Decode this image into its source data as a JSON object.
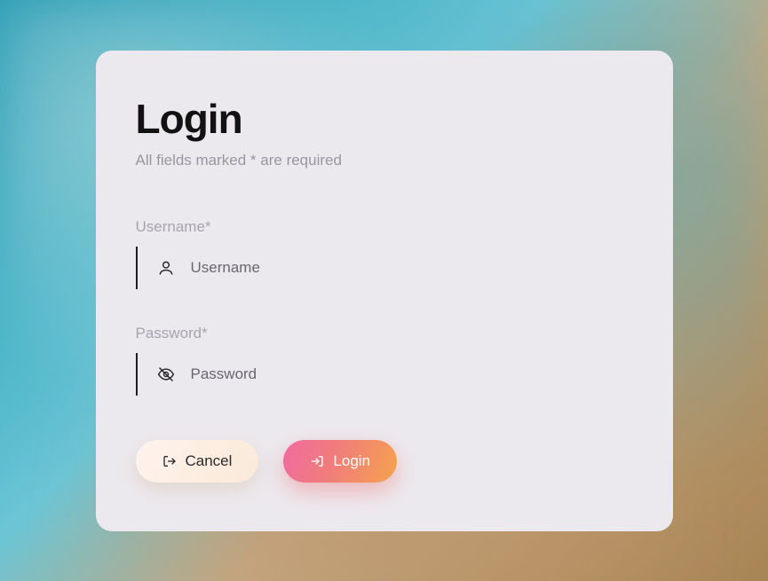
{
  "header": {
    "title": "Login",
    "subtitle": "All fields marked * are required"
  },
  "fields": {
    "username": {
      "label": "Username*",
      "placeholder": "Username",
      "value": ""
    },
    "password": {
      "label": "Password*",
      "placeholder": "Password",
      "value": ""
    }
  },
  "buttons": {
    "cancel": "Cancel",
    "login": "Login"
  }
}
